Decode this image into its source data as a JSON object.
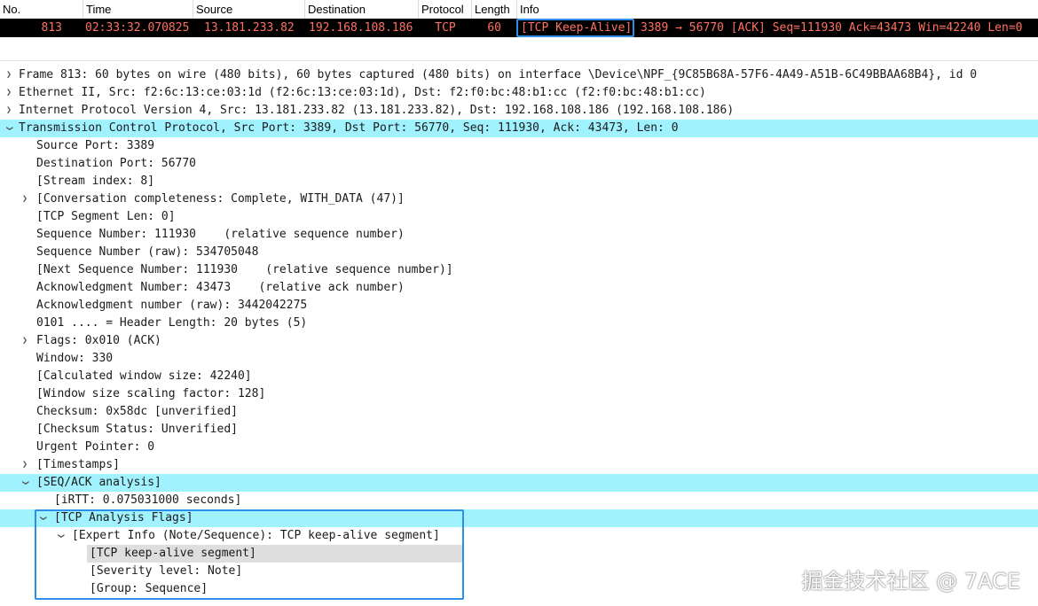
{
  "packet_list": {
    "columns": [
      "No.",
      "Time",
      "Source",
      "Destination",
      "Protocol",
      "Length",
      "Info"
    ],
    "row": {
      "no": "813",
      "time": "02:33:32.070825",
      "source": "13.181.233.82",
      "destination": "192.168.108.186",
      "protocol": "TCP",
      "length": "60",
      "info_tag": "[TCP Keep-Alive]",
      "info_rest": "3389 → 56770 [ACK] Seq=111930 Ack=43473 Win=42240 Len=0",
      "row_bg": "#000000",
      "row_text_color": "#ff7060"
    }
  },
  "details": {
    "frame": "Frame 813: 60 bytes on wire (480 bits), 60 bytes captured (480 bits) on interface \\Device\\NPF_{9C85B68A-57F6-4A49-A51B-6C49BBAA68B4}, id 0",
    "ethernet": "Ethernet II, Src: f2:6c:13:ce:03:1d (f2:6c:13:ce:03:1d), Dst: f2:f0:bc:48:b1:cc (f2:f0:bc:48:b1:cc)",
    "ip": "Internet Protocol Version 4, Src: 13.181.233.82 (13.181.233.82), Dst: 192.168.108.186 (192.168.108.186)",
    "tcp": "Transmission Control Protocol, Src Port: 3389, Dst Port: 56770, Seq: 111930, Ack: 43473, Len: 0",
    "tcp_fields": {
      "src_port": "Source Port: 3389",
      "dst_port": "Destination Port: 56770",
      "stream": "[Stream index: 8]",
      "conversation": "[Conversation completeness: Complete, WITH_DATA (47)]",
      "seg_len": "[TCP Segment Len: 0]",
      "seq": "Sequence Number: 111930    (relative sequence number)",
      "seq_raw": "Sequence Number (raw): 534705048",
      "next_seq": "[Next Sequence Number: 111930    (relative sequence number)]",
      "ack": "Acknowledgment Number: 43473    (relative ack number)",
      "ack_raw": "Acknowledgment number (raw): 3442042275",
      "header_len": "0101 .... = Header Length: 20 bytes (5)",
      "flags": "Flags: 0x010 (ACK)",
      "window": "Window: 330",
      "calc_window": "[Calculated window size: 42240]",
      "window_scale": "[Window size scaling factor: 128]",
      "checksum": "Checksum: 0x58dc [unverified]",
      "checksum_status": "[Checksum Status: Unverified]",
      "urgent": "Urgent Pointer: 0",
      "timestamps": "[Timestamps]",
      "seqack": "[SEQ/ACK analysis]"
    },
    "seqack_fields": {
      "irtt": "[iRTT: 0.075031000 seconds]",
      "analysis_flags": "[TCP Analysis Flags]"
    },
    "expert": {
      "title": "[Expert Info (Note/Sequence): TCP keep-alive segment]",
      "segment": "[TCP keep-alive segment]",
      "severity": "[Severity level: Note]",
      "group": "[Group: Sequence]"
    }
  },
  "colors": {
    "highlight": "#a0f2ff",
    "annotation_box": "#2f8fe8",
    "selected_row": "#dedede"
  },
  "icons": {
    "collapsed": "chevron-right-icon",
    "expanded": "chevron-down-icon"
  },
  "watermark": "掘金技术社区 @ 7ACE"
}
